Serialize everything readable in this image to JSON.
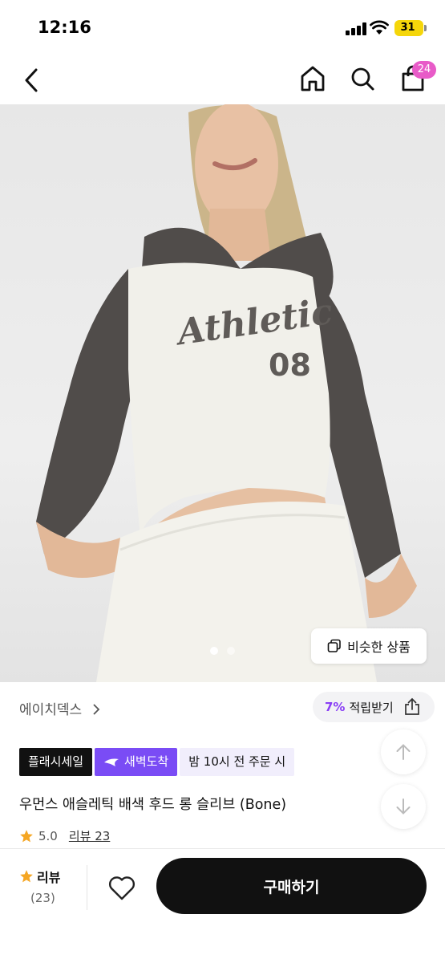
{
  "status_bar": {
    "time": "12:16",
    "battery": "31"
  },
  "nav": {
    "cart_count": "24",
    "icons": [
      "back-icon",
      "home-icon",
      "search-icon",
      "cart-icon"
    ]
  },
  "hero": {
    "similar_button": "비슷한 상품",
    "page_indicator": {
      "count": 2,
      "active": 1
    },
    "shirt_print": {
      "script": "Athletic",
      "number": "08"
    },
    "colors": {
      "sleeve": "#504c4a",
      "body": "#f1f0ea",
      "background": "#e9e9e9"
    }
  },
  "product": {
    "brand": "에이치덱스",
    "reward": {
      "percent": "7%",
      "label": "적립받기"
    },
    "badges": {
      "flash": "플래시세일",
      "dawn": "새벽도착",
      "order": "밤 10시 전 주문 시"
    },
    "title": "우먼스 애슬레틱 배색 후드 롱 슬리브 (Bone)",
    "rating": "5.0",
    "review_link": "리뷰 23"
  },
  "bottom_bar": {
    "review_label": "리뷰",
    "review_count": "(23)",
    "buy_button": "구매하기"
  },
  "colors": {
    "accent_purple": "#7a4cf5",
    "badge_pink": "#e85bc8",
    "star": "#f5a623",
    "primary": "#111111"
  }
}
